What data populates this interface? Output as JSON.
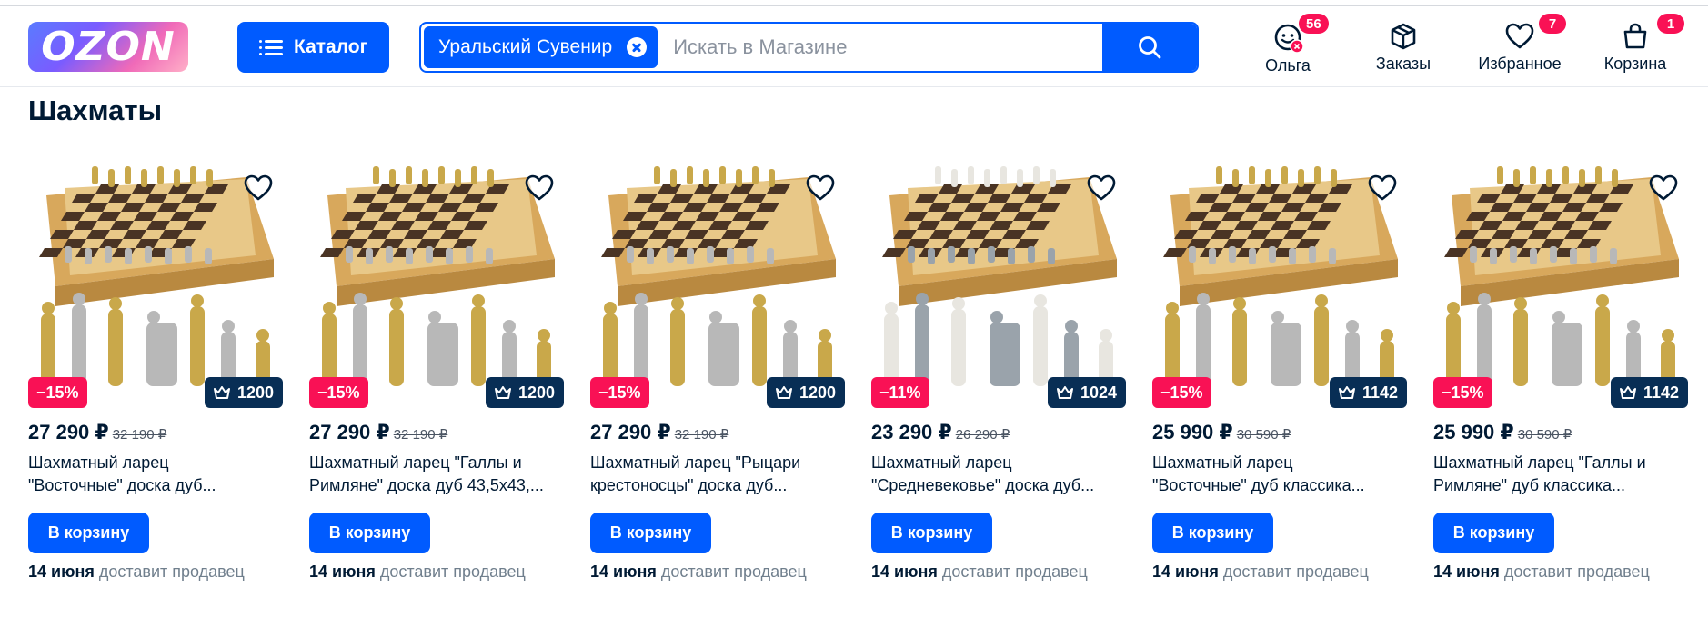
{
  "header": {
    "logo_text": "OZON",
    "catalog_label": "Каталог",
    "search_chip": "Уральский Сувенир",
    "search_placeholder": "Искать в Магазине",
    "profile": {
      "label": "Ольга",
      "badge": "56"
    },
    "orders": {
      "label": "Заказы"
    },
    "favorites": {
      "label": "Избранное",
      "badge": "7"
    },
    "cart": {
      "label": "Корзина",
      "badge": "1"
    }
  },
  "section_title": "Шахматы",
  "colors": {
    "accent": "#005bff",
    "discount": "#f91155",
    "points": "#082e55"
  },
  "products": [
    {
      "discount": "−15%",
      "points": "1200",
      "price": "27 290 ₽",
      "old_price": "32 190 ₽",
      "title_l1": "Шахматный ларец",
      "title_l2": "\"Восточные\" доска дуб...",
      "button": "В корзину",
      "delivery_date": "14 июня",
      "delivery_by": "доставит продавец",
      "variant": "gold"
    },
    {
      "discount": "−15%",
      "points": "1200",
      "price": "27 290 ₽",
      "old_price": "32 190 ₽",
      "title_l1": "Шахматный ларец \"Галлы и",
      "title_l2": "Римляне\" доска дуб 43,5х43,...",
      "button": "В корзину",
      "delivery_date": "14 июня",
      "delivery_by": "доставит продавец",
      "variant": "gold"
    },
    {
      "discount": "−15%",
      "points": "1200",
      "price": "27 290 ₽",
      "old_price": "32 190 ₽",
      "title_l1": "Шахматный ларец \"Рыцари",
      "title_l2": "крестоносцы\" доска дуб...",
      "button": "В корзину",
      "delivery_date": "14 июня",
      "delivery_by": "доставит продавец",
      "variant": "gold"
    },
    {
      "discount": "−11%",
      "points": "1024",
      "price": "23 290 ₽",
      "old_price": "26 290 ₽",
      "title_l1": "Шахматный ларец",
      "title_l2": "\"Средневековье\" доска дуб...",
      "button": "В корзину",
      "delivery_date": "14 июня",
      "delivery_by": "доставит продавец",
      "variant": "white"
    },
    {
      "discount": "−15%",
      "points": "1142",
      "price": "25 990 ₽",
      "old_price": "30 590 ₽",
      "title_l1": "Шахматный ларец",
      "title_l2": "\"Восточные\" дуб классика...",
      "button": "В корзину",
      "delivery_date": "14 июня",
      "delivery_by": "доставит продавец",
      "variant": "gold"
    },
    {
      "discount": "−15%",
      "points": "1142",
      "price": "25 990 ₽",
      "old_price": "30 590 ₽",
      "title_l1": "Шахматный ларец \"Галлы и",
      "title_l2": "Римляне\" дуб классика...",
      "button": "В корзину",
      "delivery_date": "14 июня",
      "delivery_by": "доставит продавец",
      "variant": "gold"
    }
  ]
}
